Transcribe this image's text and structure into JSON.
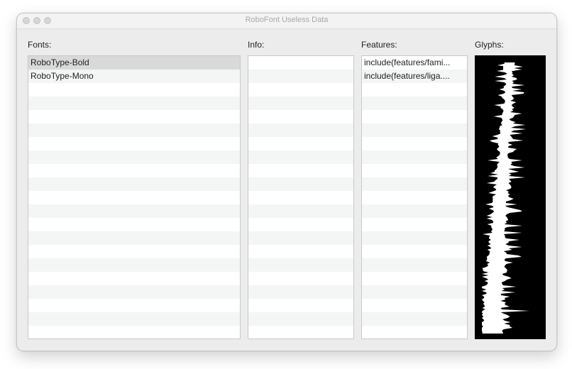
{
  "window": {
    "title": "RoboFont Useless Data"
  },
  "labels": {
    "fonts": "Fonts:",
    "info": "Info:",
    "features": "Features:",
    "glyphs": "Glyphs:"
  },
  "fonts": {
    "items": [
      "RoboType-Bold",
      "RoboType-Mono"
    ],
    "selected_index": 0
  },
  "info": {
    "items": []
  },
  "features": {
    "items": [
      "include(features/fami...",
      "include(features/liga...."
    ]
  },
  "colors": {
    "window_bg": "#ececec",
    "selection": "#d9d9d9",
    "alt_row": "#f4f5f5",
    "glyph_bg": "#000000",
    "glyph_fg": "#ffffff"
  }
}
